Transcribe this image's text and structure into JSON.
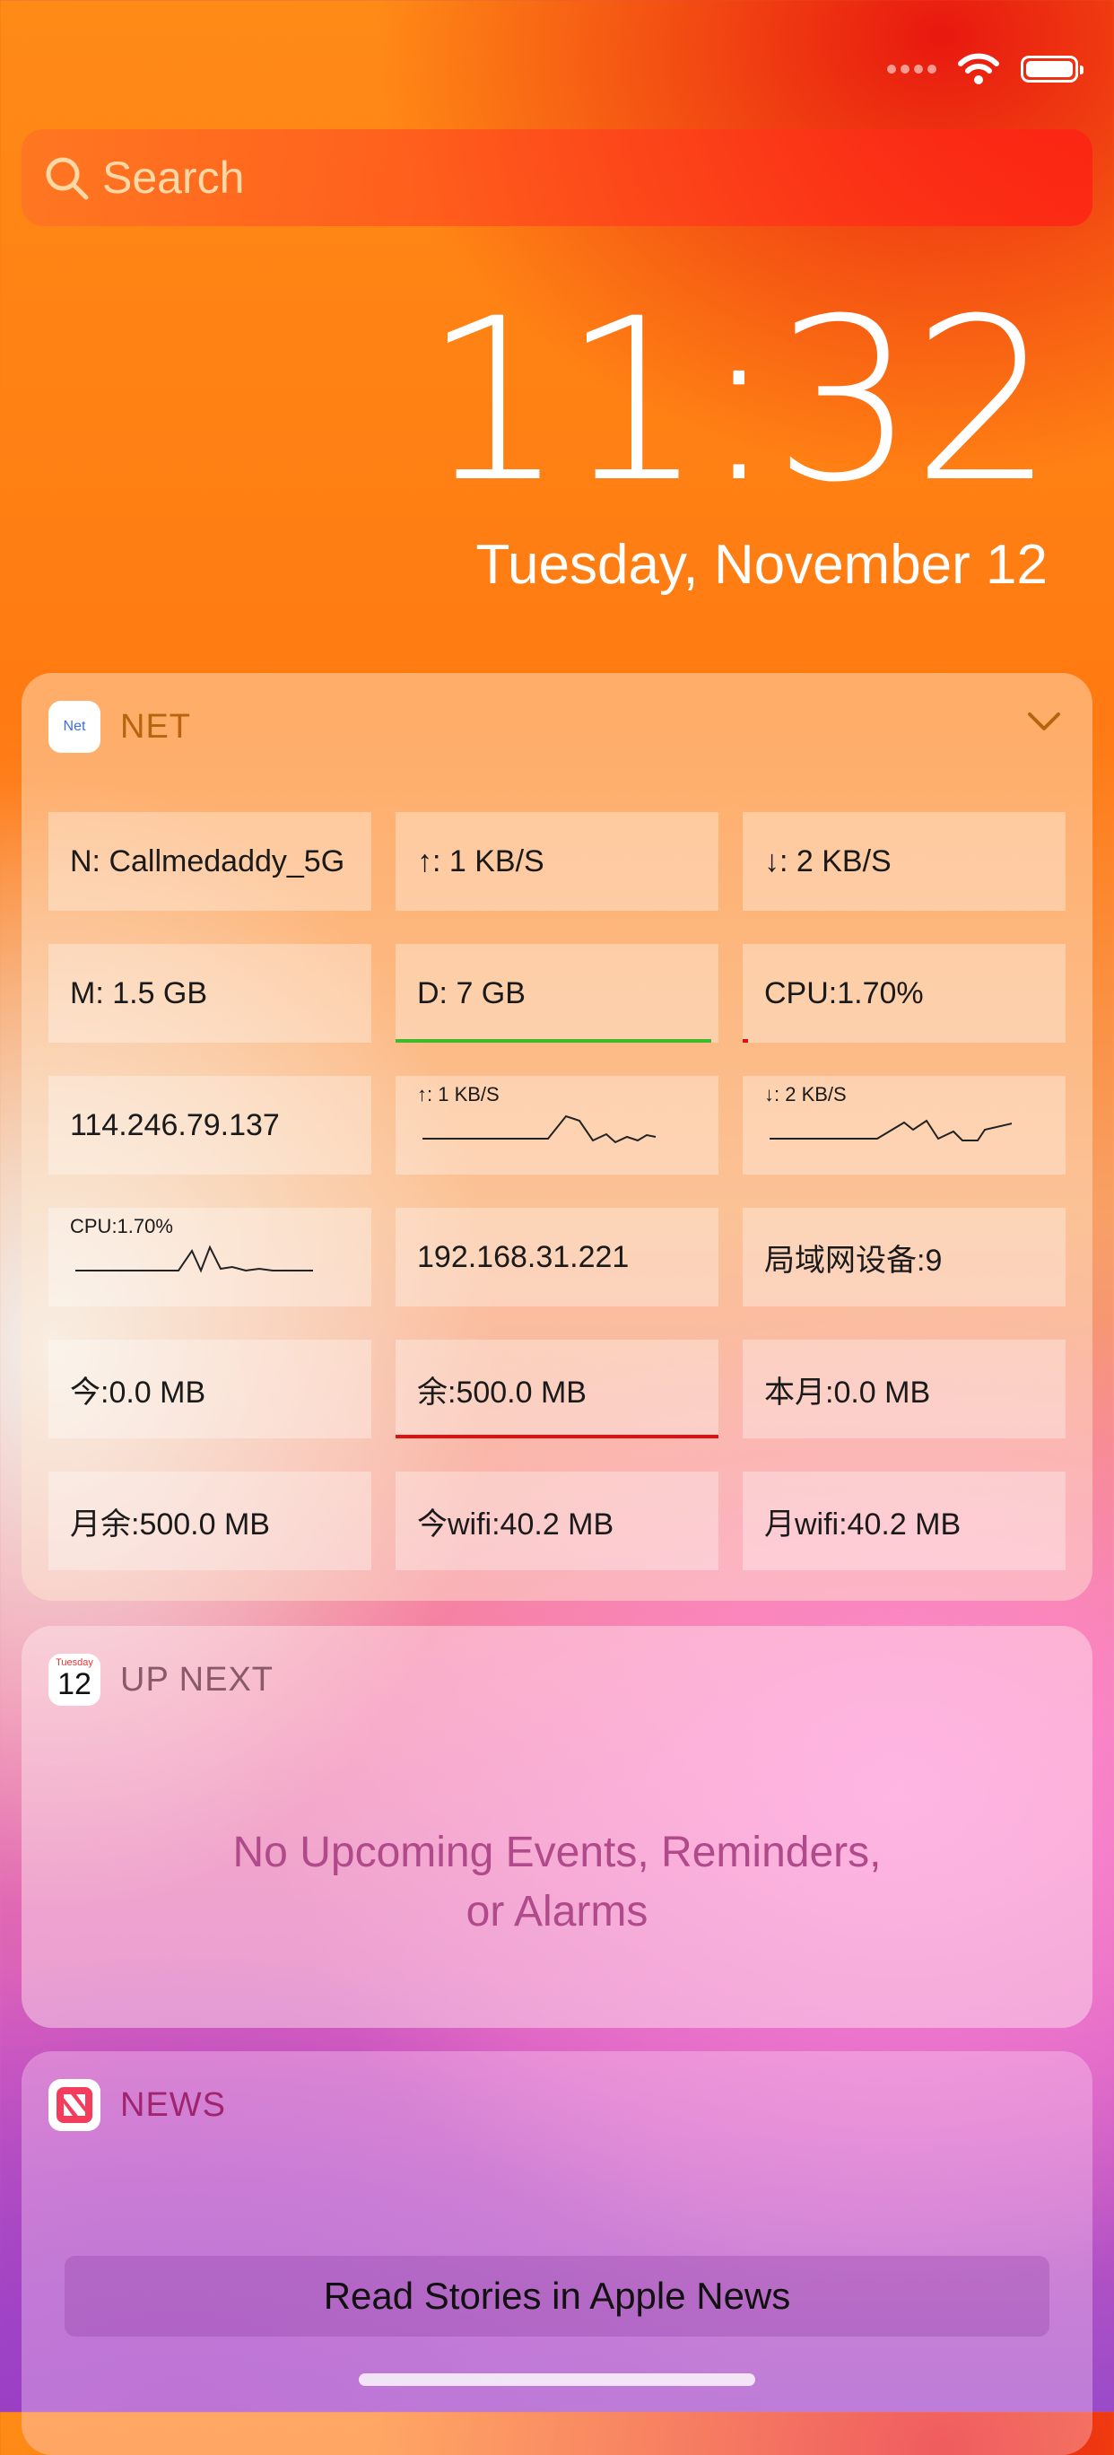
{
  "status_bar": {
    "icons": [
      "signal-dots",
      "wifi-icon",
      "battery-icon"
    ]
  },
  "search": {
    "label": "Search"
  },
  "lock": {
    "time": "11:32",
    "date": "Tuesday, November 12"
  },
  "net_widget": {
    "app_icon_text": "Net",
    "title": "NET",
    "cells": [
      "N: Callmedaddy_5G",
      "↑: 1 KB/S",
      "↓: 2 KB/S",
      "M: 1.5 GB",
      "D: 7 GB",
      "CPU:1.70%",
      "114.246.79.137",
      "↑: 1 KB/S",
      "↓: 2 KB/S",
      "CPU:1.70%",
      "192.168.31.221",
      "局域网设备:9",
      "今:0.0 MB",
      "余:500.0 MB",
      "本月:0.0 MB",
      "月余:500.0 MB",
      "今wifi:40.2 MB",
      "月wifi:40.2 MB"
    ],
    "colors": {
      "disk_bar": "#3dbb2c",
      "cpu_bar": "#e01010",
      "remaining_bar": "#e01010"
    }
  },
  "up_next": {
    "icon_dow": "Tuesday",
    "icon_day": "12",
    "title": "UP NEXT",
    "empty_line1": "No Upcoming Events, Reminders,",
    "empty_line2": "or Alarms"
  },
  "news": {
    "title": "NEWS",
    "button": "Read Stories in Apple News"
  }
}
